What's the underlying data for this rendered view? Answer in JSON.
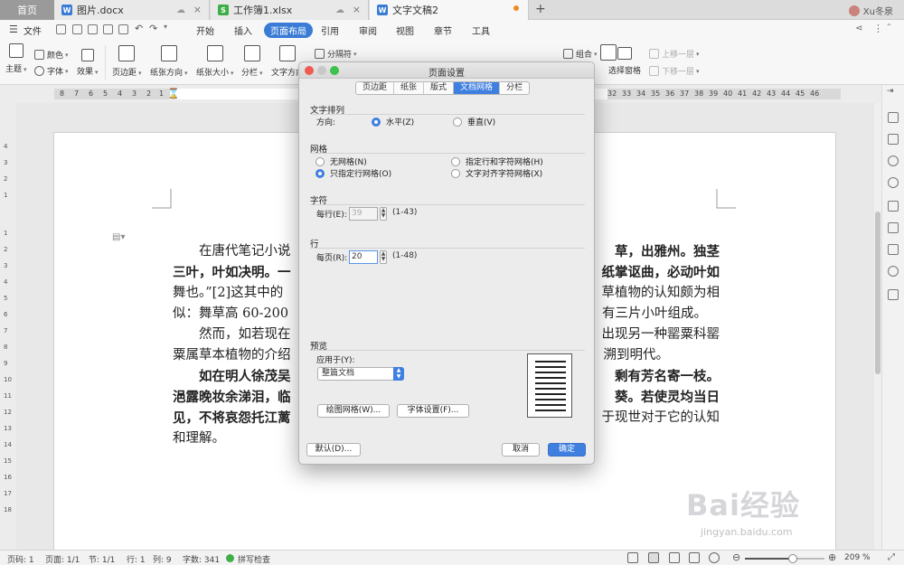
{
  "tabs": {
    "home": "首页",
    "files": [
      {
        "name": "图片.docx",
        "type": "W",
        "color": "#3a7bd5"
      },
      {
        "name": "工作簿1.xlsx",
        "type": "S",
        "color": "#3fae49"
      },
      {
        "name": "文字文稿2",
        "type": "W",
        "color": "#3a7bd5"
      }
    ],
    "add": "+",
    "user": "Xu冬泉"
  },
  "menu": {
    "file": "文件",
    "items": [
      "开始",
      "插入",
      "页面布局",
      "引用",
      "审阅",
      "视图",
      "章节",
      "工具"
    ],
    "active": "页面布局"
  },
  "ribbon": {
    "theme": "主题",
    "color": "颜色",
    "font": "字体",
    "effect": "效果",
    "margins": "页边距",
    "orientation": "纸张方向",
    "size": "纸张大小",
    "columns": "分栏",
    "text_direction": "文字方向",
    "separator": "分隔符",
    "group": "组合",
    "selection_pane": "选择窗格",
    "bring_forward": "上移一层",
    "send_backward": "下移一层"
  },
  "ruler": {
    "left_numbers": [
      "8",
      "7",
      "6",
      "5",
      "4",
      "3",
      "2",
      "1"
    ],
    "right_numbers": [
      "32",
      "33",
      "34",
      "35",
      "36",
      "37",
      "38",
      "39",
      "40",
      "41",
      "42",
      "43",
      "44",
      "45",
      "46"
    ],
    "vertical_numbers": [
      "4",
      "3",
      "2",
      "1",
      "1",
      "2",
      "3",
      "4",
      "5",
      "6",
      "7",
      "8",
      "9",
      "10",
      "11",
      "12",
      "13",
      "14",
      "15",
      "16",
      "17",
      "18"
    ]
  },
  "document": {
    "lines": [
      {
        "left": "在唐代笔记小说",
        "right": "草，出雅州。独茎",
        "right_bold": true
      },
      {
        "left": "三叶，叶如决明。一",
        "right": "纸掌讴曲，必动叶如",
        "bold": true
      },
      {
        "left": "舞也。”[2]这其中的",
        "right": "草植物的认知颇为相",
        "left_partial_bold": "舞也。"
      },
      {
        "left": "似：舞草高 60-200",
        "right": "有三片小叶组成。"
      },
      {
        "left": "然而，如若现在",
        "right": "出现另一种罂粟科罂",
        "indent": true
      },
      {
        "left": "粟属草本植物的介绍",
        "right": "溯到明代。"
      },
      {
        "left": "如在明人徐茂吴",
        "right": "剩有芳名寄一枝。",
        "bold": true,
        "indent": true
      },
      {
        "left": "浥露晚妆余涕泪，临",
        "right": "葵。若使灵均当日",
        "bold": true
      },
      {
        "left": "见，不将哀怨托江蓠",
        "right": "于现世对于它的认知",
        "left_bold": true
      },
      {
        "left": "和理解。",
        "right": ""
      }
    ]
  },
  "dialog": {
    "title": "页面设置",
    "tabs": [
      "页边距",
      "纸张",
      "版式",
      "文档网格",
      "分栏"
    ],
    "active_tab": "文档网格",
    "text_layout": {
      "heading": "文字排列",
      "direction_label": "方向:",
      "horizontal": "水平(Z)",
      "vertical": "垂直(V)"
    },
    "grid": {
      "heading": "网格",
      "none": "无网格(N)",
      "line_only": "只指定行网格(O)",
      "line_and_char": "指定行和字符网格(H)",
      "align_chars": "文字对齐字符网格(X)"
    },
    "chars": {
      "heading": "字符",
      "per_line_label": "每行(E):",
      "per_line_value": "39",
      "range": "(1-43)"
    },
    "lines": {
      "heading": "行",
      "per_page_label": "每页(R):",
      "per_page_value": "20",
      "range": "(1-48)"
    },
    "preview": {
      "heading": "预览",
      "apply_to_label": "应用于(Y):",
      "apply_to_value": "整篇文档"
    },
    "draw_grid_button": "绘图网格(W)...",
    "font_settings_button": "字体设置(F)...",
    "default_button": "默认(D)...",
    "cancel_button": "取消",
    "ok_button": "确定"
  },
  "statusbar": {
    "page_number": "页码: 1",
    "pages": "页面: 1/1",
    "section": "节: 1/1",
    "row": "行: 1",
    "column": "列: 9",
    "word_count": "字数: 341",
    "spellcheck": "拼写检查",
    "zoom": "209 %",
    "zoom_fraction": 0.6
  },
  "watermark": {
    "brand": "Bai经验",
    "url": "jingyan.baidu.com"
  }
}
